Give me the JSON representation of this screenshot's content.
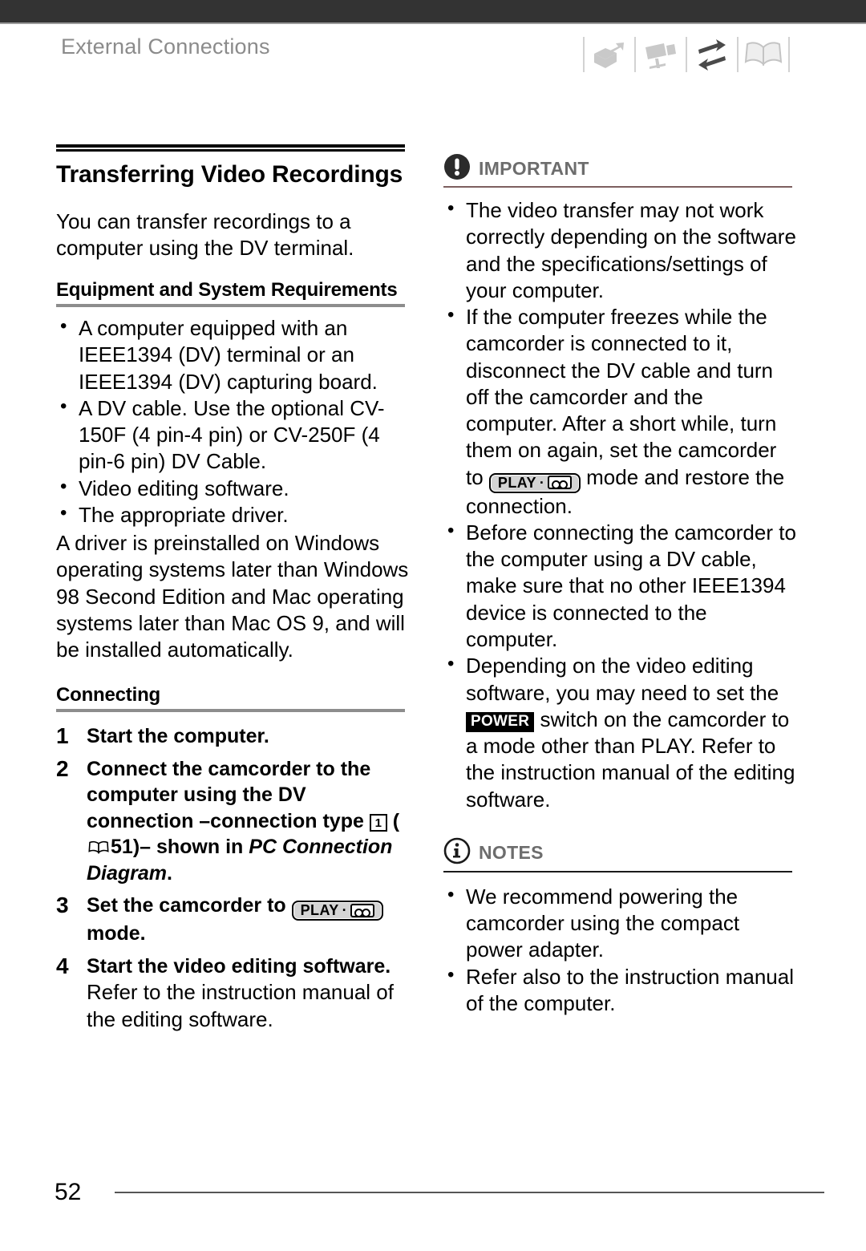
{
  "header": {
    "running_title": "External Connections",
    "icons": [
      {
        "name": "unpacking-box-icon",
        "state": "inactive"
      },
      {
        "name": "camcorder-icon",
        "state": "inactive"
      },
      {
        "name": "exchange-arrows-icon",
        "state": "active"
      },
      {
        "name": "open-book-icon",
        "state": "inactive"
      }
    ]
  },
  "left": {
    "section_title": "Transferring Video Recordings",
    "intro": "You can transfer recordings to a computer using the DV terminal.",
    "requirements_heading": "Equipment and System Requirements",
    "requirements": [
      "A computer equipped with an IEEE1394 (DV) terminal or an IEEE1394 (DV) capturing board.",
      "A DV cable. Use the optional CV-150F (4 pin-4 pin) or CV-250F (4 pin-6 pin) DV Cable.",
      "Video editing software.",
      "The appropriate driver."
    ],
    "driver_note": "A driver is preinstalled on Windows operating systems later than Windows 98 Second Edition and Mac operating systems later than Mac OS 9, and will be installed automatically.",
    "connecting_heading": "Connecting",
    "steps": [
      {
        "number": "1",
        "text": "Start the computer."
      },
      {
        "number": "2",
        "text_a": "Connect the camcorder to the computer using the DV connection –connection type ",
        "box_number": "1",
        "text_b": " (",
        "page_ref": "51",
        "text_c": ")– shown in ",
        "italic": "PC Connection Diagram",
        "text_d": "."
      },
      {
        "number": "3",
        "text_a": "Set the camcorder to ",
        "badge": "PLAY",
        "text_b": " mode."
      },
      {
        "number": "4",
        "text": "Start the video editing software.",
        "note": "Refer to the instruction manual of the editing software."
      }
    ]
  },
  "right": {
    "important": {
      "label": "IMPORTANT",
      "icon": "exclamation-circle-icon",
      "rule_color": "#7d5f5f",
      "bullets": [
        {
          "text": "The video transfer may not work correctly depending on the software and the specifications/settings of your computer."
        },
        {
          "text_a": "If the computer freezes while the camcorder is connected to it, disconnect the DV cable and turn off the camcorder and the computer. After a short while, turn them on again, set the camcorder to ",
          "badge": "PLAY",
          "text_b": " mode and restore the connection."
        },
        {
          "text": "Before connecting the camcorder to the computer using a DV cable, make sure that no other IEEE1394 device is connected to the computer."
        },
        {
          "text_a": "Depending on the video editing software, you may need to set the ",
          "badge_power": "POWER",
          "text_b": " switch on the camcorder to a mode other than PLAY. Refer to the instruction manual of the editing software."
        }
      ]
    },
    "notes": {
      "label": "NOTES",
      "icon": "info-circle-icon",
      "rule_color": "#1a1a1a",
      "bullets": [
        "We recommend powering the camcorder using the compact power adapter.",
        "Refer also to the instruction manual of the computer."
      ]
    }
  },
  "footer": {
    "page_number": "52"
  }
}
